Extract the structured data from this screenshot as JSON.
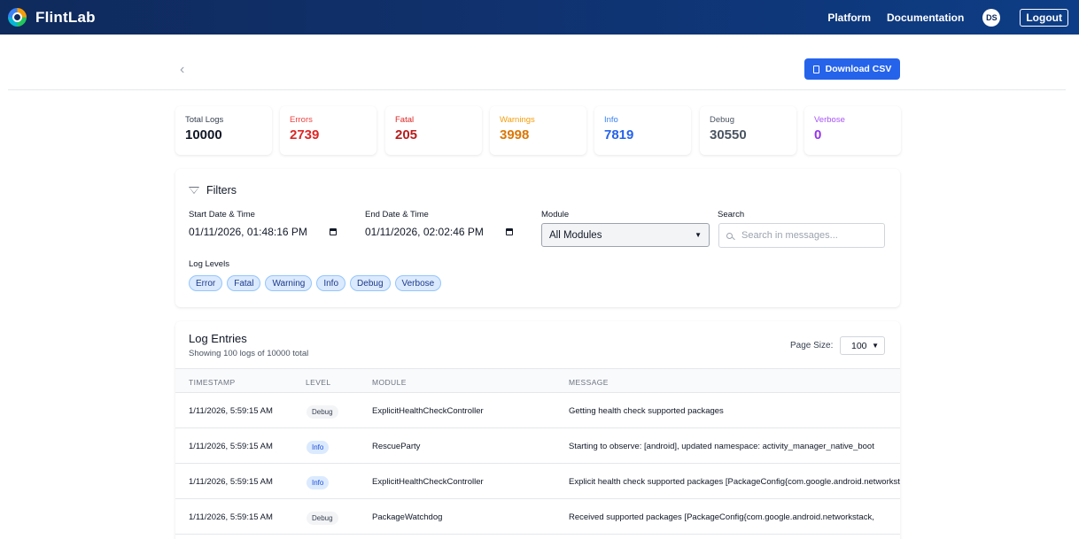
{
  "nav": {
    "brand": "FlintLab",
    "links": [
      "Platform",
      "Documentation"
    ],
    "avatar_initials": "DS",
    "logout": "Logout"
  },
  "toolbar": {
    "back_glyph": "‹",
    "download_label": "Download CSV"
  },
  "stats": [
    {
      "label": "Total Logs",
      "value": "10000",
      "label_color": "#374151",
      "value_color": "#111827"
    },
    {
      "label": "Errors",
      "value": "2739",
      "label_color": "#ef4444",
      "value_color": "#dc2626"
    },
    {
      "label": "Fatal",
      "value": "205",
      "label_color": "#dc2626",
      "value_color": "#b91c1c"
    },
    {
      "label": "Warnings",
      "value": "3998",
      "label_color": "#f59e0b",
      "value_color": "#d97706"
    },
    {
      "label": "Info",
      "value": "7819",
      "label_color": "#3b82f6",
      "value_color": "#2563eb"
    },
    {
      "label": "Debug",
      "value": "30550",
      "label_color": "#4b5563",
      "value_color": "#4b5563"
    },
    {
      "label": "Verbose",
      "value": "0",
      "label_color": "#a855f7",
      "value_color": "#9333ea"
    }
  ],
  "filters": {
    "title": "Filters",
    "start_label": "Start Date & Time",
    "start_value": "01/11/2026, 01:48:16 PM",
    "end_label": "End Date & Time",
    "end_value": "01/11/2026, 02:02:46 PM",
    "module_label": "Module",
    "module_value": "All Modules",
    "search_label": "Search",
    "search_placeholder": "Search in messages...",
    "levels_label": "Log Levels",
    "levels": [
      "Error",
      "Fatal",
      "Warning",
      "Info",
      "Debug",
      "Verbose"
    ]
  },
  "logs": {
    "title": "Log Entries",
    "subtitle": "Showing 100 logs of 10000 total",
    "page_size_label": "Page Size:",
    "page_size_value": "100",
    "columns": [
      "TIMESTAMP",
      "LEVEL",
      "MODULE",
      "MESSAGE"
    ],
    "rows": [
      {
        "timestamp": "1/11/2026, 5:59:15 AM",
        "level": "Debug",
        "module": "ExplicitHealthCheckController",
        "message": "Getting health check supported packages"
      },
      {
        "timestamp": "1/11/2026, 5:59:15 AM",
        "level": "Info",
        "module": "RescueParty",
        "message": "Starting to observe: [android], updated namespace: activity_manager_native_boot"
      },
      {
        "timestamp": "1/11/2026, 5:59:15 AM",
        "level": "Info",
        "module": "ExplicitHealthCheckController",
        "message": "Explicit health check supported packages [PackageConfig{com.google.android.networkstack"
      },
      {
        "timestamp": "1/11/2026, 5:59:15 AM",
        "level": "Debug",
        "module": "PackageWatchdog",
        "message": "Received supported packages [PackageConfig{com.google.android.networkstack, "
      }
    ]
  }
}
